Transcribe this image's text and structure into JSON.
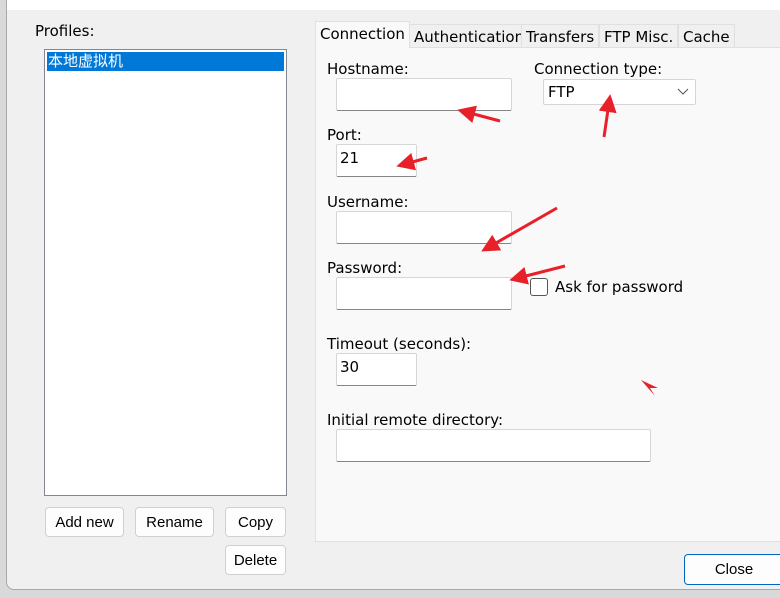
{
  "profiles": {
    "label": "Profiles:",
    "items": [
      "本地虚拟机"
    ],
    "selected": 0
  },
  "buttons": {
    "add_new": "Add new",
    "rename": "Rename",
    "copy": "Copy",
    "delete": "Delete",
    "close": "Close"
  },
  "tabs": [
    {
      "label": "Connection",
      "active": true
    },
    {
      "label": "Authentication"
    },
    {
      "label": "Transfers"
    },
    {
      "label": "FTP Misc."
    },
    {
      "label": "Cache"
    }
  ],
  "connection": {
    "hostname": {
      "label": "Hostname:",
      "value": ""
    },
    "connection_type": {
      "label": "Connection type:",
      "value": "FTP"
    },
    "port": {
      "label": "Port:",
      "value": "21"
    },
    "username": {
      "label": "Username:",
      "value": ""
    },
    "password": {
      "label": "Password:",
      "value": ""
    },
    "ask_password": {
      "label": "Ask for password",
      "checked": false
    },
    "timeout": {
      "label": "Timeout (seconds):",
      "value": "30"
    },
    "remote_dir": {
      "label": "Initial remote directory:",
      "value": ""
    }
  },
  "colors": {
    "selection": "#0078d7",
    "annotation_arrows": "#e8202a"
  }
}
